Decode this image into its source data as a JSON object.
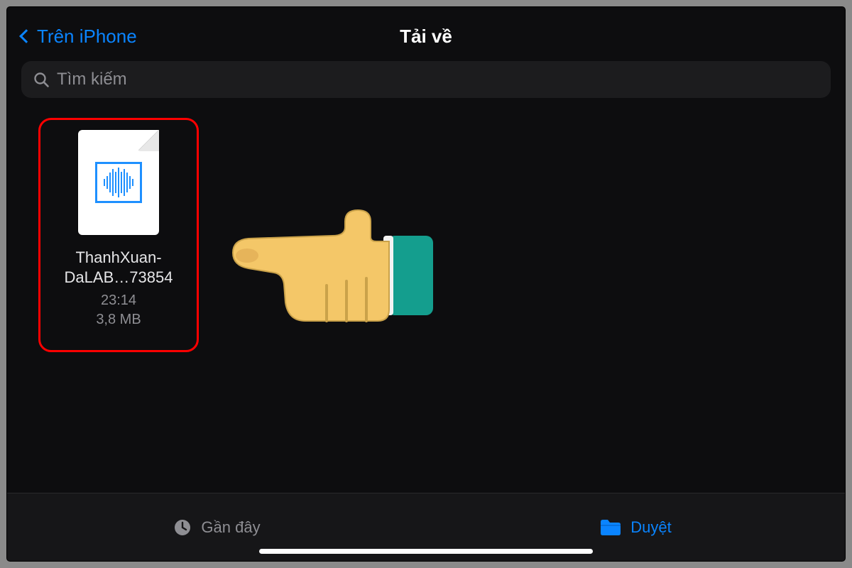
{
  "nav": {
    "back_label": "Trên iPhone",
    "title": "Tải về"
  },
  "search": {
    "placeholder": "Tìm kiếm"
  },
  "file": {
    "name_line1": "ThanhXuan-",
    "name_line2": "DaLAB…73854",
    "time": "23:14",
    "size": "3,8 MB"
  },
  "tabs": {
    "recents_label": "Gần đây",
    "browse_label": "Duyệt"
  },
  "colors": {
    "accent": "#0a84ff",
    "highlight_box": "#ff0000"
  }
}
